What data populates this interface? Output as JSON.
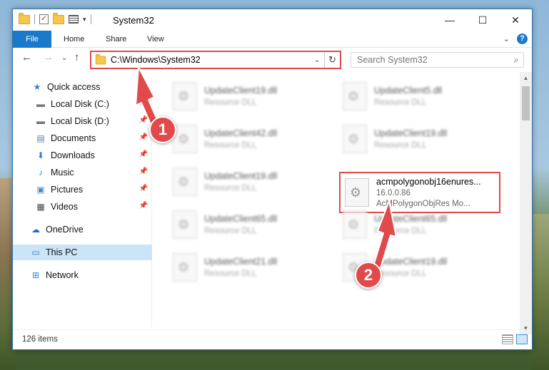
{
  "window": {
    "title": "System32",
    "controls": {
      "minimize": "—",
      "maximize": "☐",
      "close": "✕"
    }
  },
  "ribbon": {
    "tabs": [
      "File",
      "Home",
      "Share",
      "View"
    ],
    "collapse_glyph": "⌄",
    "help_glyph": "?"
  },
  "nav": {
    "back": "←",
    "forward": "→",
    "recent": "⌄",
    "up": "↑",
    "address": "C:\\Windows\\System32",
    "address_dropdown": "⌄",
    "refresh": "↻",
    "search_placeholder": "Search System32"
  },
  "sidebar": {
    "items": [
      {
        "label": "Quick access",
        "icon": "star-icon",
        "glyph": "★"
      },
      {
        "label": "Local Disk (C:)",
        "icon": "drive-icon",
        "glyph": "▬",
        "pinned": true
      },
      {
        "label": "Local Disk (D:)",
        "icon": "drive-icon",
        "glyph": "▬",
        "pinned": true
      },
      {
        "label": "Documents",
        "icon": "documents-icon",
        "glyph": "▤",
        "pinned": true
      },
      {
        "label": "Downloads",
        "icon": "download-icon",
        "glyph": "⬇",
        "pinned": true
      },
      {
        "label": "Music",
        "icon": "music-icon",
        "glyph": "♪",
        "pinned": true
      },
      {
        "label": "Pictures",
        "icon": "pictures-icon",
        "glyph": "▣",
        "pinned": true
      },
      {
        "label": "Videos",
        "icon": "videos-icon",
        "glyph": "▦",
        "pinned": true
      },
      {
        "label": "OneDrive",
        "icon": "cloud-icon",
        "glyph": "☁"
      },
      {
        "label": "This PC",
        "icon": "computer-icon",
        "glyph": "▭"
      },
      {
        "label": "Network",
        "icon": "network-icon",
        "glyph": "⊞"
      }
    ]
  },
  "files": {
    "left_column": [
      {
        "name": "UpdateClient19.dll",
        "type": "Resource DLL"
      },
      {
        "name": "UpdateClient42.dll",
        "type": "Resource DLL"
      },
      {
        "name": "UpdateClient19.dll",
        "type": "Resource DLL"
      },
      {
        "name": "UpdateClient65.dll",
        "type": "Resource DLL"
      },
      {
        "name": "UpdateClient21.dll",
        "type": "Resource DLL"
      }
    ],
    "right_column": [
      {
        "name": "UpdateClient5.dll",
        "type": "Resource DLL"
      },
      {
        "name": "UpdateClient19.dll",
        "type": "Resource DLL"
      },
      {
        "name": "UpdateClient65.dll",
        "type": "Resource DLL"
      },
      {
        "name": "UpdateClient19.dll",
        "type": "Resource DLL"
      }
    ],
    "highlighted": {
      "name": "acmpolygonobj16enures...",
      "version": "16.0.0.86",
      "description": "AcMPolygonObjRes Mo..."
    }
  },
  "status": {
    "item_count": "126 items"
  },
  "callouts": {
    "one": "1",
    "two": "2"
  },
  "colors": {
    "accent": "#1979ca",
    "callout": "#e04a4a",
    "selected": "#cce4f7"
  }
}
